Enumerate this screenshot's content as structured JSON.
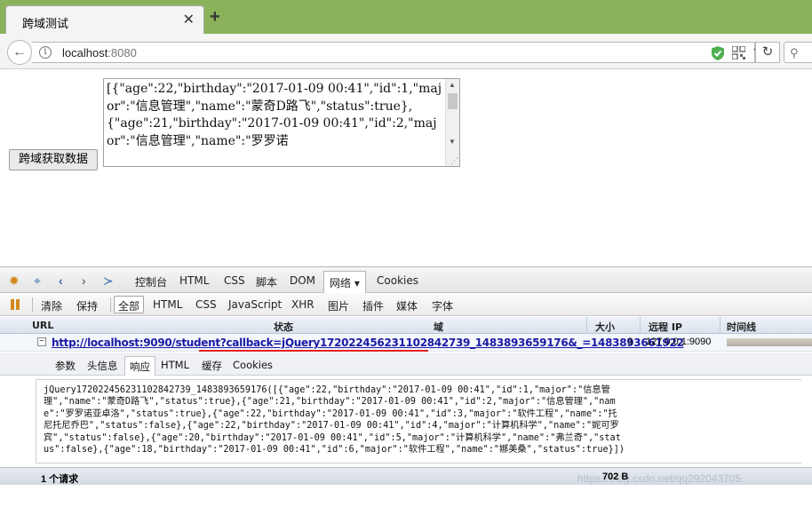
{
  "browser": {
    "tab_title": "跨域测试",
    "tab_close": "✕",
    "new_tab": "+",
    "url_host": "localhost",
    "url_port": ":8080"
  },
  "page": {
    "fetch_button": "跨域获取数据",
    "result_text": "[{\"age\":22,\"birthday\":\"2017-01-09 00:41\",\"id\":1,\"major\":\"信息管理\",\"name\":\"蒙奇D路飞\",\"status\":true},\n{\"age\":21,\"birthday\":\"2017-01-09 00:41\",\"id\":2,\"major\":\"信息管理\",\"name\":\"罗罗诺"
  },
  "devtools": {
    "main_tabs": [
      "控制台",
      "HTML",
      "CSS",
      "脚本",
      "DOM",
      "网络 ▾",
      "Cookies"
    ],
    "filters": [
      "清除",
      "保持",
      "全部",
      "HTML",
      "CSS",
      "JavaScript",
      "XHR",
      "图片",
      "插件",
      "媒体",
      "字体"
    ],
    "columns": {
      "url": "URL",
      "status": "状态",
      "domain": "域",
      "size": "大小",
      "remote_ip": "远程 IP",
      "timeline": "时间线"
    },
    "request": {
      "url": "http://localhost:9090/student?callback=jQuery17202245623110284273 9_1483893659176&_=1483893661922",
      "url_display": "http://localhost:9090/student?callback=jQuery172022456231102842739_1483893659176&_=1483893661922",
      "size": "3",
      "remote_ip": "127.0.0.1:9090"
    },
    "response_tabs": [
      "参数",
      "头信息",
      "响应",
      "HTML",
      "缓存",
      "Cookies"
    ],
    "response_text": "jQuery172022456231102842739_1483893659176([{\"age\":22,\"birthday\":\"2017-01-09 00:41\",\"id\":1,\"major\":\"信息管理\",\"name\":\"蒙奇D路飞\",\"status\":true},{\"age\":21,\"birthday\":\"2017-01-09 00:41\",\"id\":2,\"major\":\"信息管理\",\"name\":\"罗罗诺亚卓洛\",\"status\":true},{\"age\":22,\"birthday\":\"2017-01-09 00:41\",\"id\":3,\"major\":\"软件工程\",\"name\":\"托尼托尼乔巴\",\"status\":false},{\"age\":22,\"birthday\":\"2017-01-09 00:41\",\"id\":4,\"major\":\"计算机科学\",\"name\":\"妮可罗宾\",\"status\":false},{\"age\":20,\"birthday\":\"2017-01-09 00:41\",\"id\":5,\"major\":\"计算机科学\",\"name\":\"弗兰奇\",\"status\":false},{\"age\":18,\"birthday\":\"2017-01-09 00:41\",\"id\":6,\"major\":\"软件工程\",\"name\":\"娜美桑\",\"status\":true}])",
    "request_count": "1 个请求",
    "total_size": "702 B",
    "watermark": "https://blog.csdn.net/qq292043705"
  },
  "colors": {
    "tabbar": "#8ab25b",
    "link": "#1a1aa6",
    "highlight_underline": "#e02020"
  }
}
